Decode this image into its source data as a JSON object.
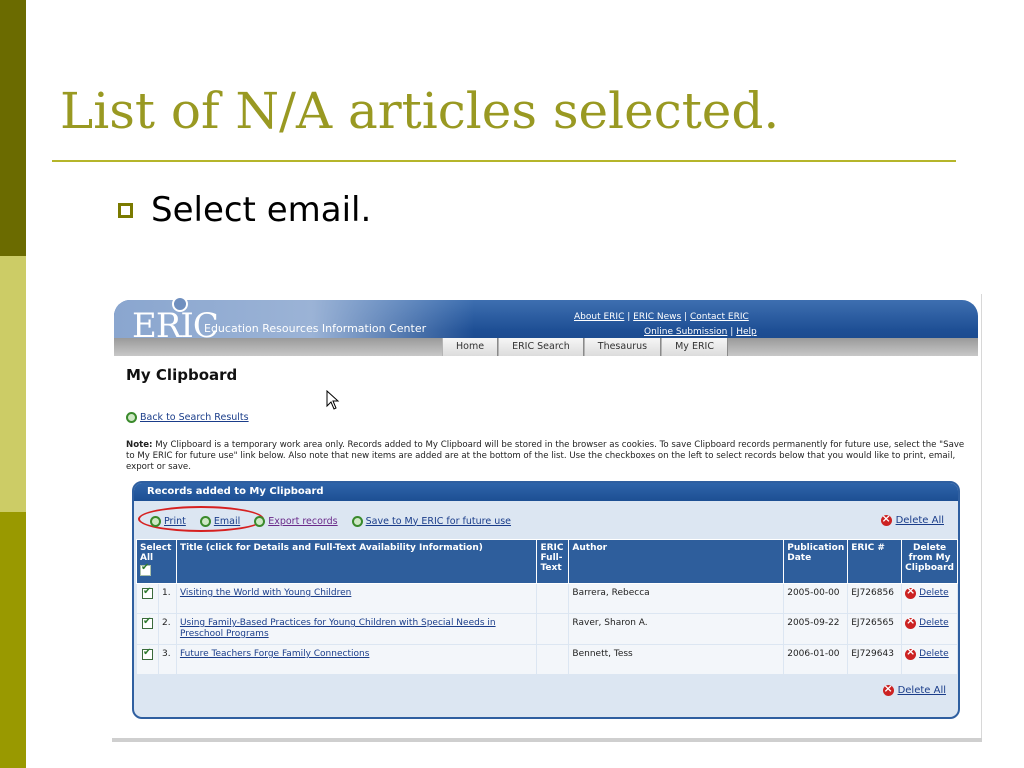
{
  "slide": {
    "title": "List of N/A articles selected.",
    "bullet": "Select email."
  },
  "colors": {
    "title": "#999922",
    "sidebar": [
      "#6b6b00",
      "#cccc66",
      "#999900"
    ],
    "eric_blue": "#1e4f95",
    "highlight_ring": "#d62020"
  },
  "eric": {
    "logo": "ERIC",
    "tagline": "Education Resources Information Center",
    "top_links_row1": [
      "About ERIC",
      "ERIC News",
      "Contact ERIC"
    ],
    "top_links_row2": [
      "Online Submission",
      "Help"
    ],
    "separator": "|",
    "nav_tabs": [
      "Home",
      "ERIC Search",
      "Thesaurus",
      "My ERIC"
    ]
  },
  "page": {
    "title": "My Clipboard",
    "back_link": "Back to Search Results",
    "note_label": "Note:",
    "note_text": " My Clipboard is a temporary work area only. Records added to My Clipboard will be stored in the browser as cookies. To save Clipboard records permanently for future use, select the \"Save to My ERIC for future use\" link below. Also note that new items are added are at the bottom of the list. Use the checkboxes on the left to select records below that you would like to print, email, export or save."
  },
  "panel": {
    "header": "Records added to My Clipboard",
    "toolbar": {
      "print": "Print",
      "email": "Email",
      "export": "Export records",
      "save": "Save to My ERIC for future use",
      "delete_all": "Delete All"
    },
    "columns": {
      "select_all": "Select All",
      "title": "Title (click for Details and Full-Text Availability Information)",
      "fulltext": "ERIC Full-Text",
      "author": "Author",
      "pubdate": "Publication Date",
      "eric_num": "ERIC #",
      "delete": "Delete from My Clipboard"
    },
    "rows": [
      {
        "num": "1.",
        "title": "Visiting the World with Young Children",
        "author": "Barrera, Rebecca",
        "date": "2005-00-00",
        "eric": "EJ726856",
        "delete": "Delete",
        "checked": true
      },
      {
        "num": "2.",
        "title": "Using Family-Based Practices for Young Children with Special Needs in Preschool Programs",
        "author": "Raver, Sharon A.",
        "date": "2005-09-22",
        "eric": "EJ726565",
        "delete": "Delete",
        "checked": true
      },
      {
        "num": "3.",
        "title": "Future Teachers Forge Family Connections",
        "author": "Bennett, Tess",
        "date": "2006-01-00",
        "eric": "EJ729643",
        "delete": "Delete",
        "checked": true
      }
    ],
    "delete_all_bottom": "Delete All"
  }
}
